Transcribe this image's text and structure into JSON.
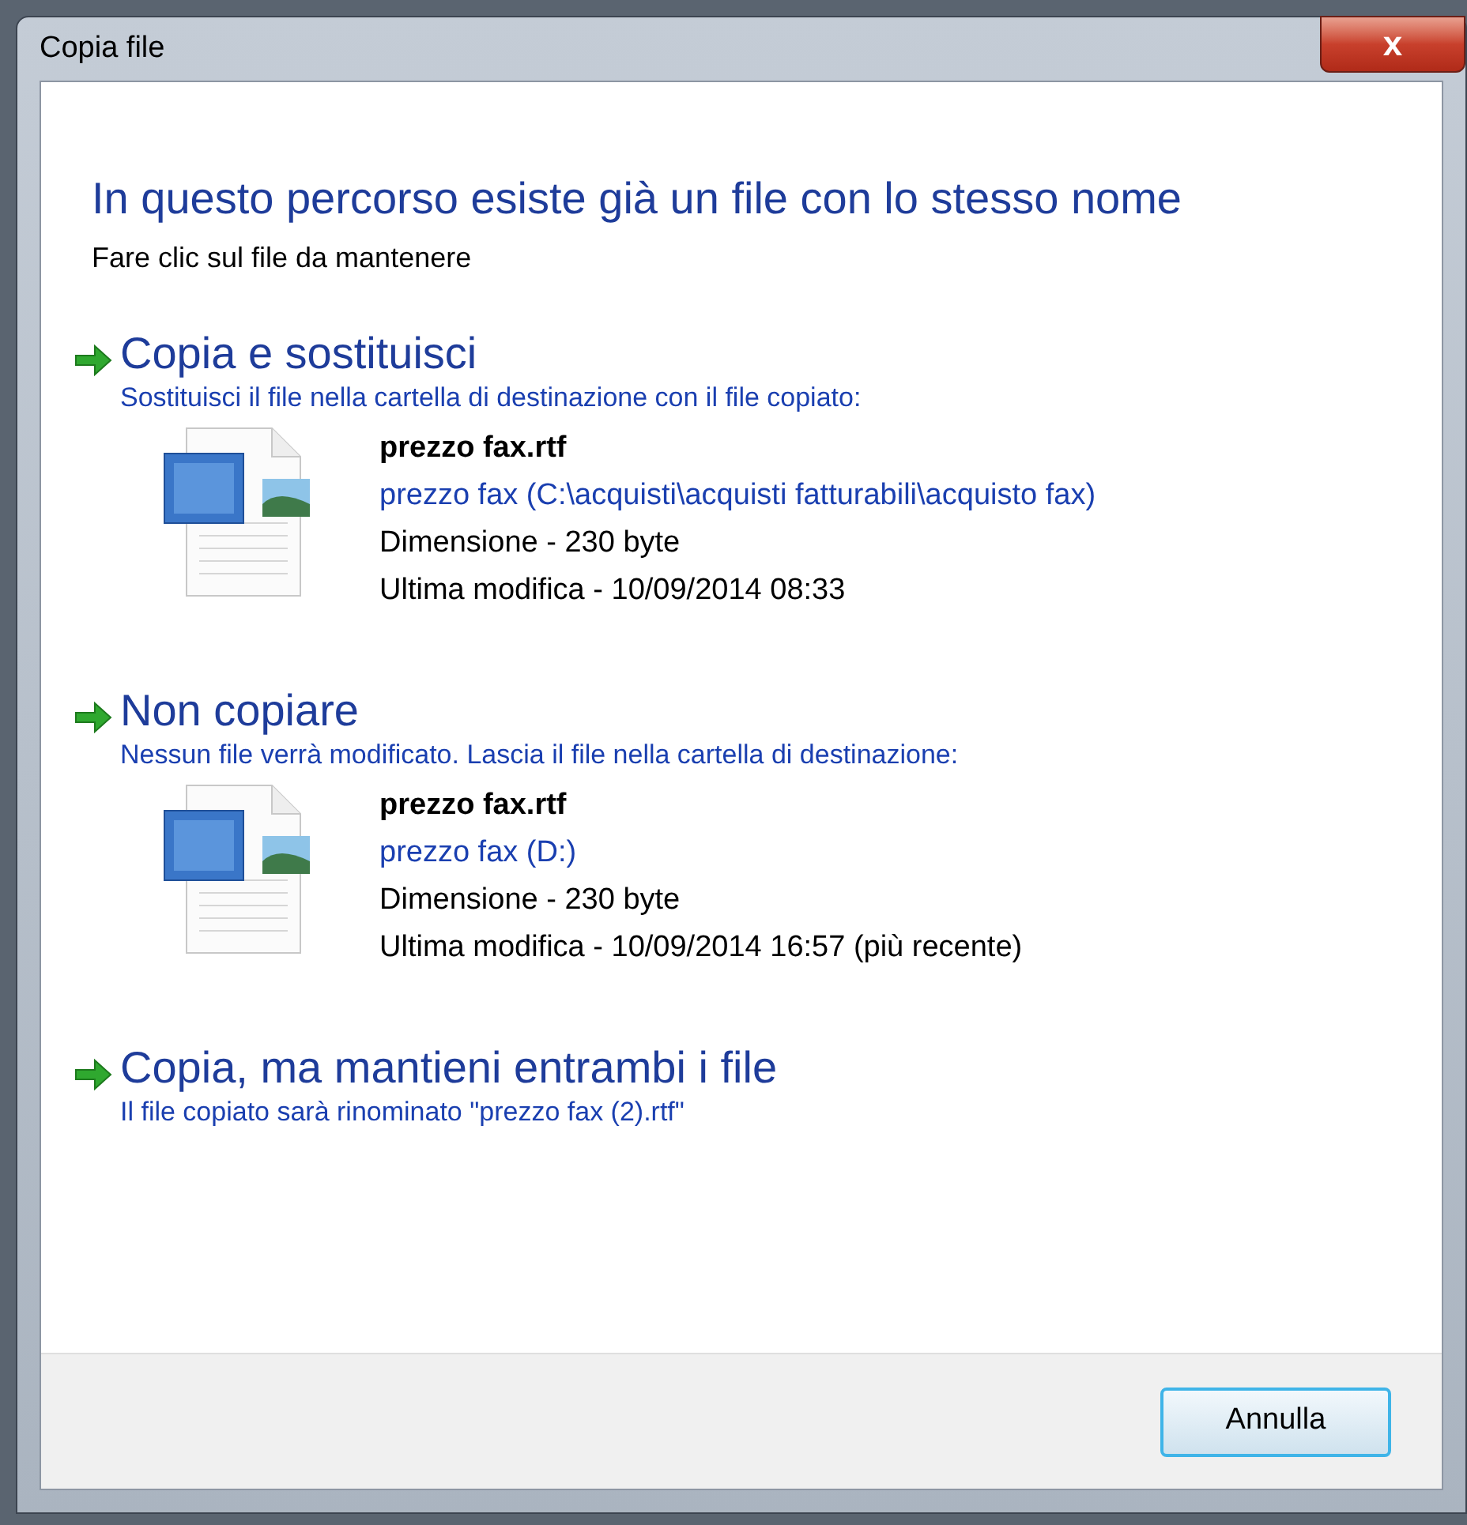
{
  "window": {
    "title": "Copia file",
    "close_button": "x"
  },
  "heading": "In questo percorso esiste già un file con lo stesso nome",
  "instruction": "Fare clic sul file da mantenere",
  "options": [
    {
      "title": "Copia e sostituisci",
      "description": "Sostituisci il file nella cartella di destinazione con il file copiato:",
      "file": {
        "name": "prezzo fax.rtf",
        "location": "prezzo fax (C:\\acquisti\\acquisti fatturabili\\acquisto fax)",
        "size": "Dimensione - 230 byte",
        "modified": "Ultima modifica - 10/09/2014 08:33"
      }
    },
    {
      "title": "Non copiare",
      "description": "Nessun file verrà modificato. Lascia il file nella cartella di destinazione:",
      "file": {
        "name": "prezzo fax.rtf",
        "location": "prezzo fax (D:)",
        "size": "Dimensione - 230 byte",
        "modified": "Ultima modifica - 10/09/2014 16:57 (più recente)"
      }
    },
    {
      "title": "Copia, ma mantieni entrambi i file",
      "description": "Il file copiato sarà rinominato \"prezzo fax (2).rtf\""
    }
  ],
  "buttons": [
    "Annulla"
  ]
}
